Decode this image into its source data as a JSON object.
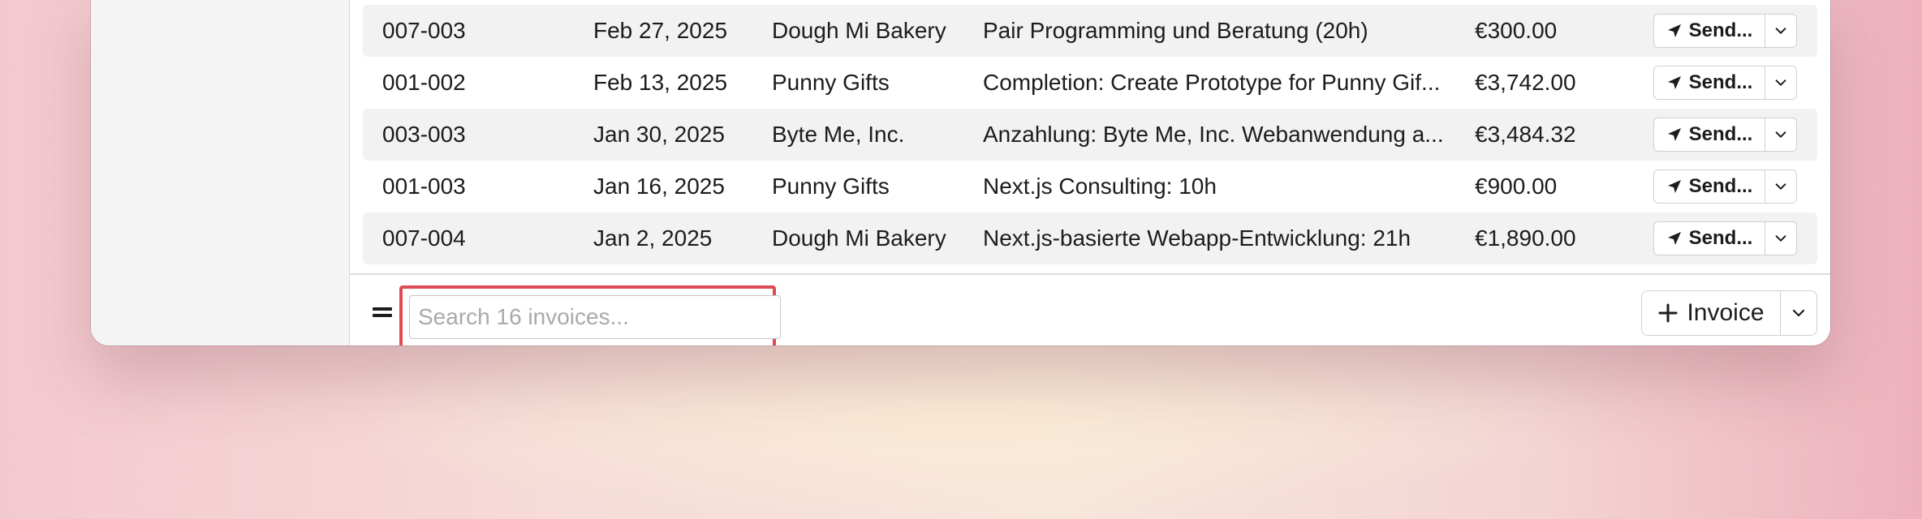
{
  "invoices": [
    {
      "number": "007-003",
      "date": "Feb 27, 2025",
      "client": "Dough Mi Bakery",
      "description": "Pair Programming und Beratung (20h)",
      "amount": "€300.00",
      "action_label": "Send..."
    },
    {
      "number": "001-002",
      "date": "Feb 13, 2025",
      "client": "Punny Gifts",
      "description": "Completion: Create Prototype for Punny Gif...",
      "amount": "€3,742.00",
      "action_label": "Send..."
    },
    {
      "number": "003-003",
      "date": "Jan 30, 2025",
      "client": "Byte Me, Inc.",
      "description": "Anzahlung: Byte Me, Inc. Webanwendung a...",
      "amount": "€3,484.32",
      "action_label": "Send..."
    },
    {
      "number": "001-003",
      "date": "Jan 16, 2025",
      "client": "Punny Gifts",
      "description": "Next.js Consulting: 10h",
      "amount": "€900.00",
      "action_label": "Send..."
    },
    {
      "number": "007-004",
      "date": "Jan 2, 2025",
      "client": "Dough Mi Bakery",
      "description": "Next.js-basierte Webapp-Entwicklung: 21h",
      "amount": "€1,890.00",
      "action_label": "Send..."
    }
  ],
  "footer": {
    "search_placeholder": "Search 16 invoices...",
    "new_invoice_label": "Invoice",
    "filter_icon": "filter-icon",
    "highlight_color": "#e04a55"
  }
}
